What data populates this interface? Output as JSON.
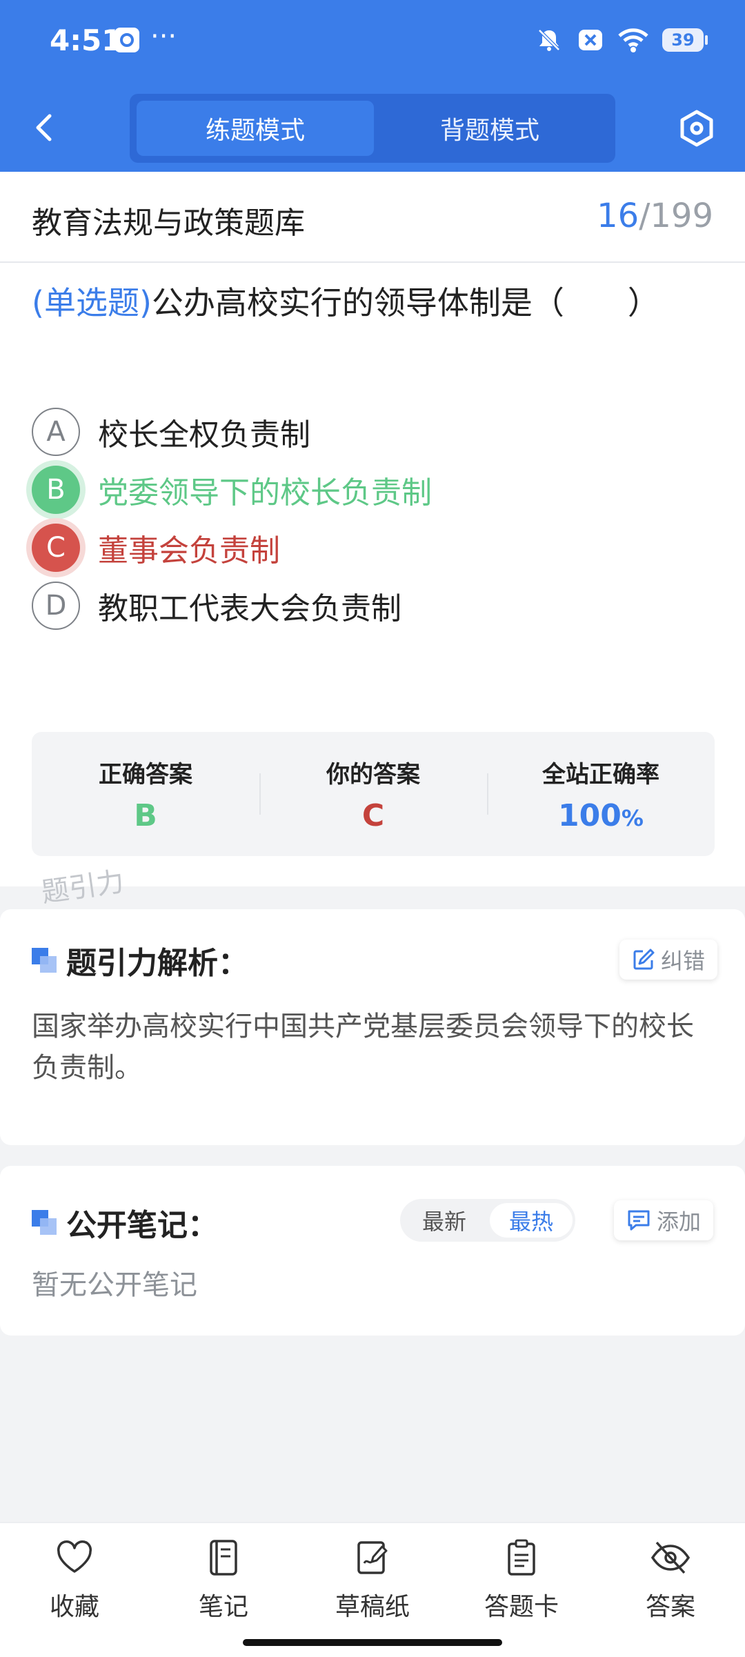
{
  "status_bar": {
    "time": "4:51",
    "extra": "···",
    "battery": "39"
  },
  "nav": {
    "back_icon": "chevron-left-icon",
    "tabs": [
      {
        "label": "练题模式",
        "active": true
      },
      {
        "label": "背题模式",
        "active": false
      }
    ],
    "settings_icon": "hex-settings-icon"
  },
  "question_bank": {
    "title": "教育法规与政策题库",
    "current": "16",
    "separator": "/",
    "total": "199"
  },
  "question": {
    "type": "(单选题)",
    "text": "公办高校实行的领导体制是（　　）",
    "options": [
      {
        "letter": "A",
        "text": "校长全权负责制",
        "state": "normal"
      },
      {
        "letter": "B",
        "text": "党委领导下的校长负责制",
        "state": "correct"
      },
      {
        "letter": "C",
        "text": "董事会负责制",
        "state": "wrong"
      },
      {
        "letter": "D",
        "text": "教职工代表大会负责制",
        "state": "normal"
      }
    ]
  },
  "stats": {
    "correct_label": "正确答案",
    "correct_value": "B",
    "yours_label": "你的答案",
    "yours_value": "C",
    "rate_label": "全站正确率",
    "rate_value": "100",
    "rate_unit": "%"
  },
  "watermark": "题引力",
  "analysis": {
    "title": "题引力解析：",
    "report_label": "纠错",
    "text": "国家举办高校实行中国共产党基层委员会领导下的校长负责制。"
  },
  "notes": {
    "title": "公开笔记：",
    "sort_new": "最新",
    "sort_hot": "最热",
    "add_label": "添加",
    "empty": "暂无公开笔记"
  },
  "bottom_bar": [
    {
      "icon": "heart-icon",
      "label": "收藏"
    },
    {
      "icon": "notebook-icon",
      "label": "笔记"
    },
    {
      "icon": "draft-paper-icon",
      "label": "草稿纸"
    },
    {
      "icon": "answer-card-icon",
      "label": "答题卡"
    },
    {
      "icon": "eye-off-icon",
      "label": "答案"
    }
  ],
  "colors": {
    "primary": "#3b7de9",
    "correct": "#5ec887",
    "wrong": "#d6534d"
  }
}
